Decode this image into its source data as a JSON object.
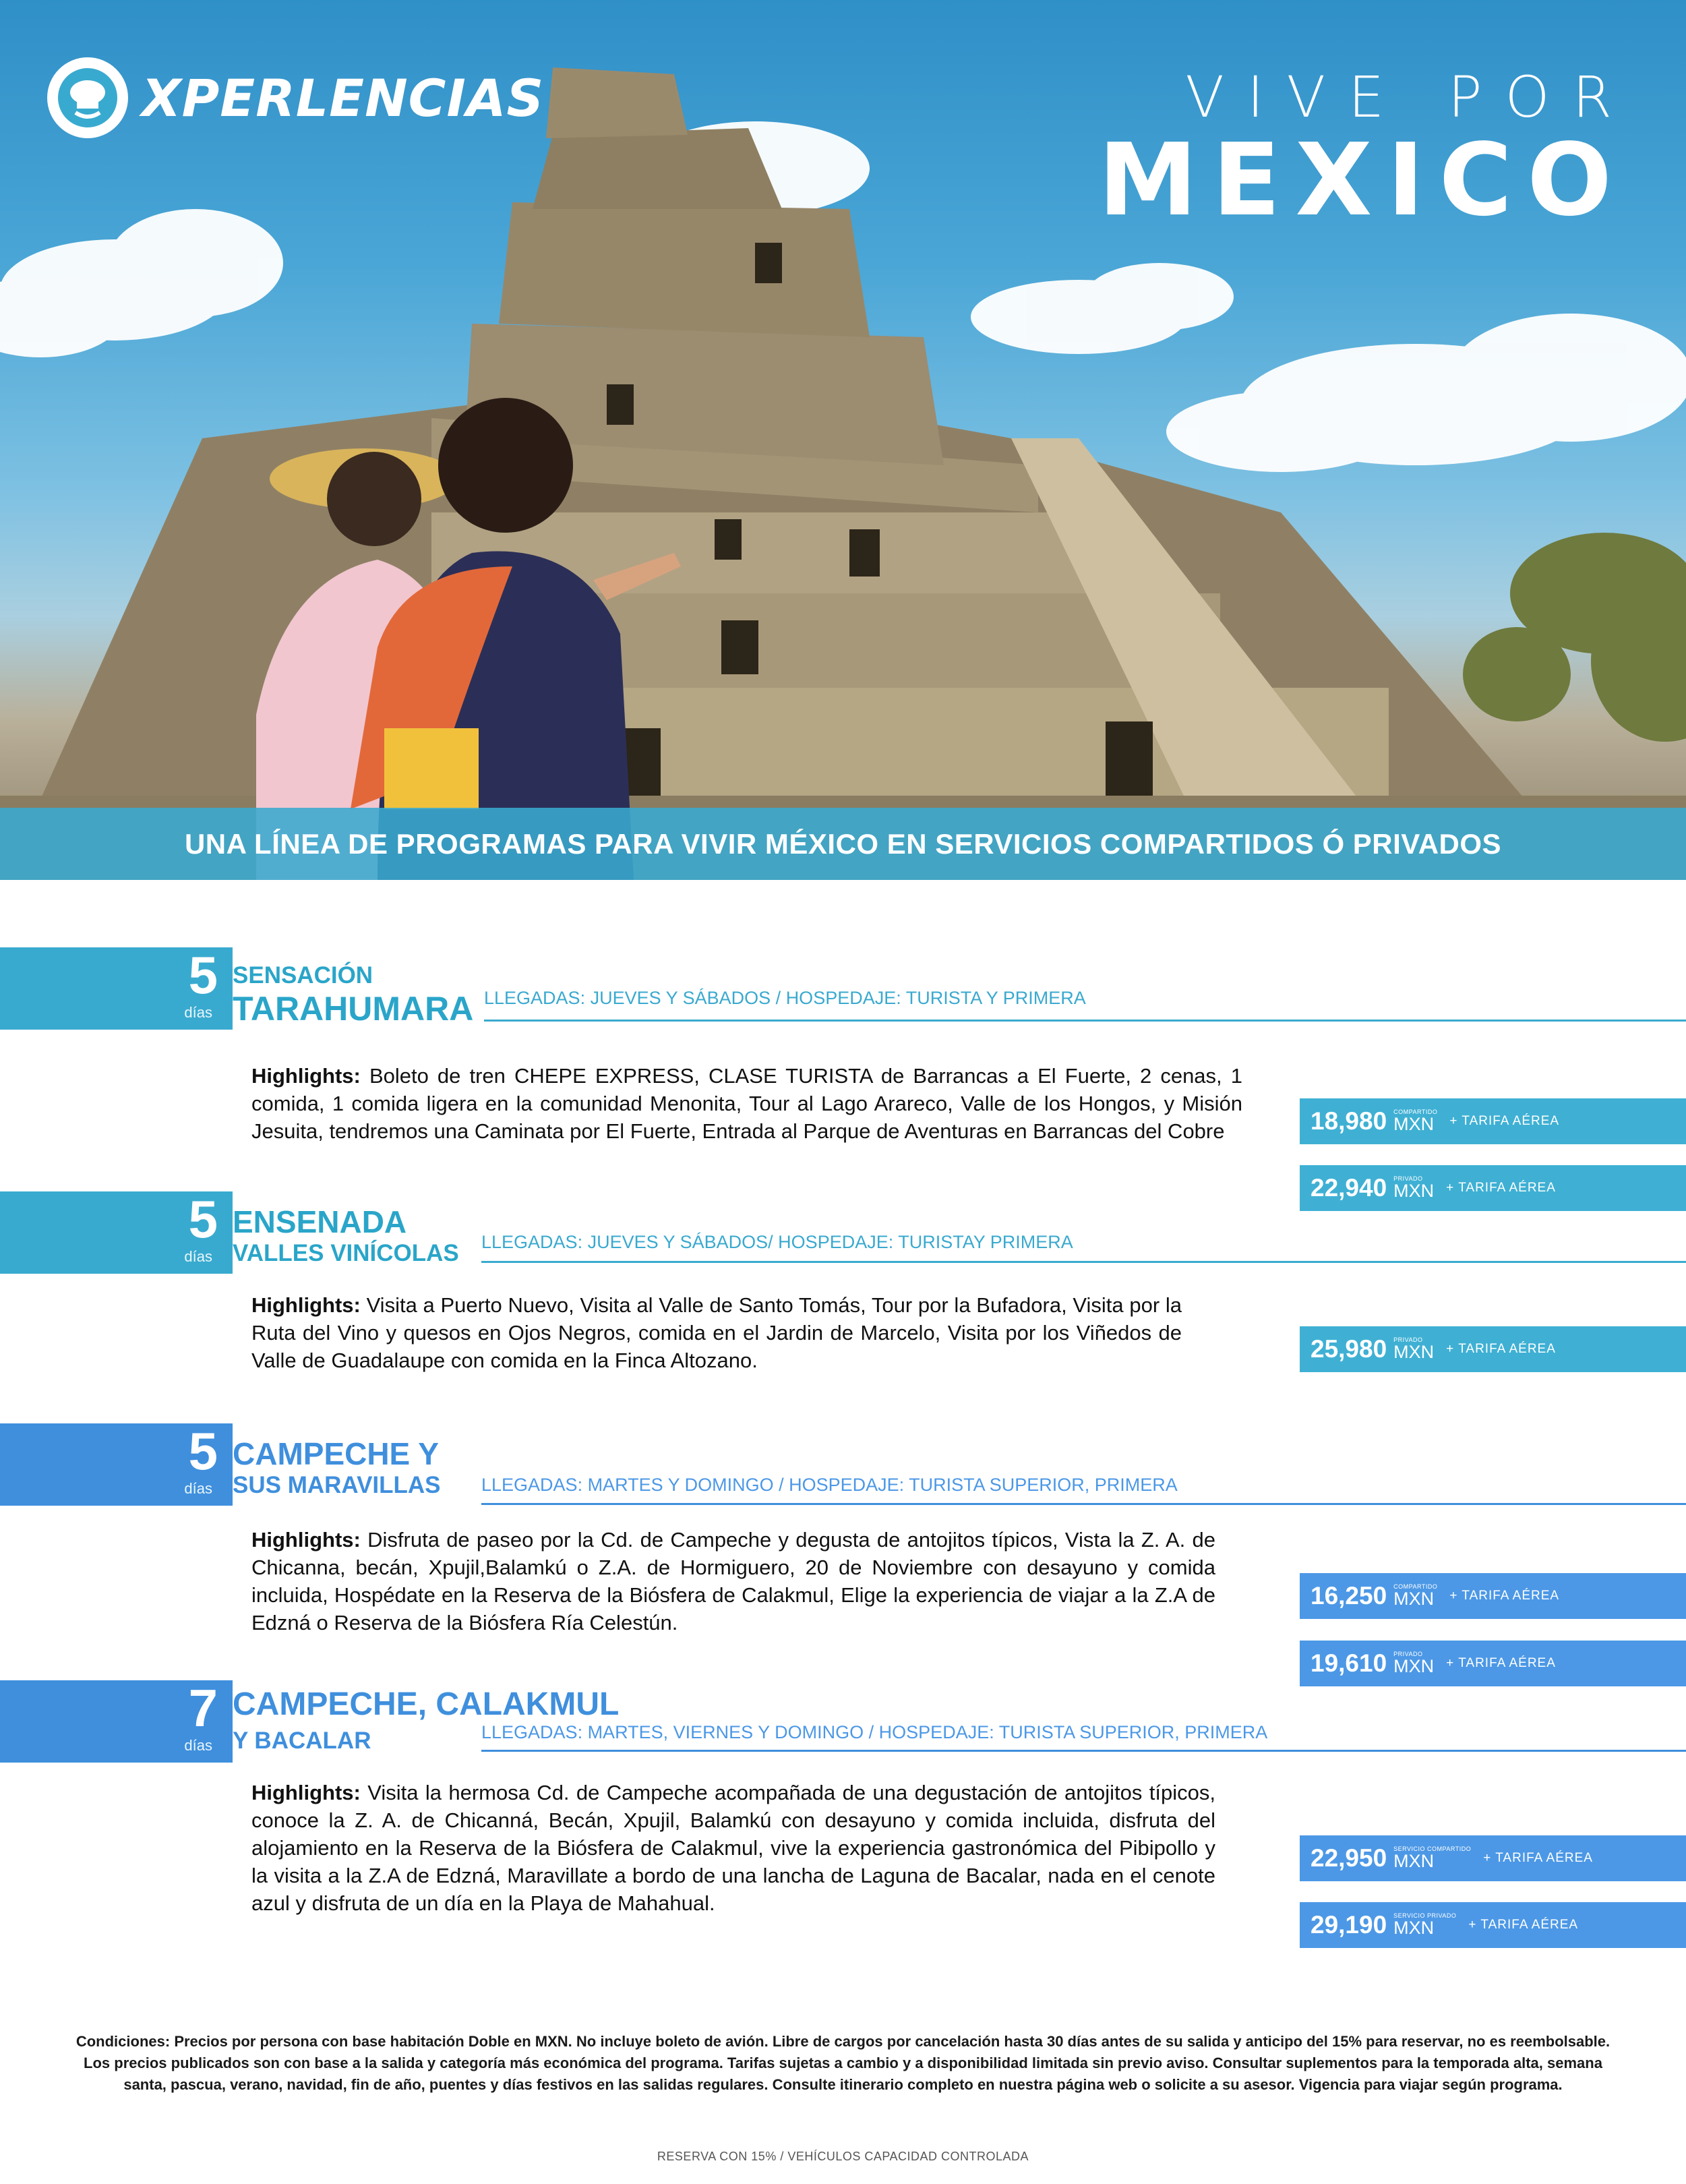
{
  "header": {
    "logo_text": "XPERLENCIAS",
    "tagline_top": "VIVE POR",
    "tagline_main": "MEXICO",
    "banner": "UNA LÍNEA DE PROGRAMAS PARA VIVIR MÉXICO EN SERVICIOS COMPARTIDOS Ó PRIVADOS"
  },
  "day_label": "días",
  "programs": [
    {
      "days": "5",
      "title_line1": "SENSACIÓN",
      "title_line2": "TARAHUMARA",
      "llegadas": "LLEGADAS: JUEVES Y SÁBADOS / HOSPEDAJE: TURISTA Y PRIMERA",
      "highlights_label": "Highlights:",
      "highlights": "Boleto de tren CHEPE EXPRESS, CLASE TURISTA de Barrancas a El Fuerte, 2 cenas, 1 comida, 1 comida ligera en la comunidad Menonita, Tour al Lago Arareco, Valle de los Hongos, y Misión Jesuita, tendremos una Caminata por El Fuerte, Entrada al Parque de Aventuras en Barrancas del Cobre",
      "prices": [
        {
          "value": "18,980",
          "tiny": "COMPARTIDO",
          "currency": "MXN",
          "tarifa": "+ TARIFA AÉREA"
        },
        {
          "value": "22,940",
          "tiny": "PRIVADO",
          "currency": "MXN",
          "tarifa": "+ TARIFA AÉREA"
        }
      ]
    },
    {
      "days": "5",
      "title_line1": "ENSENADA",
      "title_line2": "VALLES VINÍCOLAS",
      "llegadas": "LLEGADAS: JUEVES Y SÁBADOS/ HOSPEDAJE: TURISTAY PRIMERA",
      "highlights_label": "Highlights:",
      "highlights": "Visita a Puerto Nuevo, Visita al Valle de Santo Tomás, Tour por la Bufadora, Visita por la Ruta del Vino y quesos en Ojos Negros, comida en el Jardin de Marcelo, Visita por los Viñedos de Valle de Guadalaupe con comida en la Finca Altozano.",
      "prices": [
        {
          "value": "25,980",
          "tiny": "PRIVADO",
          "currency": "MXN",
          "tarifa": "+ TARIFA AÉREA"
        }
      ]
    },
    {
      "days": "5",
      "title_line1": "CAMPECHE Y",
      "title_line2": "SUS MARAVILLAS",
      "llegadas": "LLEGADAS: MARTES Y DOMINGO / HOSPEDAJE: TURISTA SUPERIOR, PRIMERA",
      "highlights_label": "Highlights:",
      "highlights": "Disfruta de paseo por la Cd. de Campeche y degusta de antojitos típicos, Vista la Z. A. de Chicanna, becán, Xpujil,Balamkú o Z.A. de Hormiguero, 20 de Noviembre con desayuno y comida incluida, Hospédate en la Reserva de la Biósfera de Calakmul, Elige la experiencia de viajar a la Z.A de Edzná o Reserva de la Biósfera Ría Celestún.",
      "prices": [
        {
          "value": "16,250",
          "tiny": "COMPARTIDO",
          "currency": "MXN",
          "tarifa": "+ TARIFA AÉREA"
        },
        {
          "value": "19,610",
          "tiny": "PRIVADO",
          "currency": "MXN",
          "tarifa": "+ TARIFA AÉREA"
        }
      ]
    },
    {
      "days": "7",
      "title_line1": "CAMPECHE, CALAKMUL",
      "title_line2": "Y BACALAR",
      "llegadas": "LLEGADAS: MARTES, VIERNES Y DOMINGO / HOSPEDAJE: TURISTA SUPERIOR, PRIMERA",
      "highlights_label": "Highlights:",
      "highlights": "Visita la hermosa Cd. de Campeche acompañada de una degustación de antojitos típicos, conoce la Z. A. de Chicanná, Becán, Xpujil, Balamkú con desayuno y comida incluida, disfruta del alojamiento en la Reserva de la Biósfera de Calakmul, vive la experiencia gastronómica del Pibipollo y la visita a la Z.A de Edzná, Maravillate a bordo de una lancha de Laguna de Bacalar, nada en el cenote azul y disfruta de un día en la Playa de Mahahual.",
      "prices": [
        {
          "value": "22,950",
          "tiny": "SERVICIO COMPARTIDO",
          "currency": "MXN",
          "tarifa": "+ TARIFA AÉREA"
        },
        {
          "value": "29,190",
          "tiny": "SERVICIO PRIVADO",
          "currency": "MXN",
          "tarifa": "+ TARIFA AÉREA"
        }
      ]
    }
  ],
  "footer": {
    "conditions_label": "Condiciones:",
    "conditions": "Precios por persona con base habitación Doble en MXN. No incluye boleto de avión. Libre de cargos por cancelación hasta 30 días antes de su salida y anticipo del 15% para reservar, no es reembolsable. Los precios publicados son con base a la salida y categoría más económica del programa. Tarifas sujetas a cambio y a disponibilidad limitada sin previo aviso. Consultar suplementos para la temporada alta, semana santa, pascua, verano, navidad, fin de año, puentes y días festivos en las salidas regulares. Consulte itinerario completo en nuestra página web o solicite a su asesor. Vigencia para viajar según programa.",
    "reserva": "RESERVA CON 15% / VEHÍCULOS CAPACIDAD CONTROLADA"
  },
  "colors": {
    "teal": "#39aacf",
    "title_teal": "#2aa5c9",
    "blue": "#3f8fdd",
    "price_teal": "#3fb0d4",
    "price_blue": "#4c98e6"
  }
}
